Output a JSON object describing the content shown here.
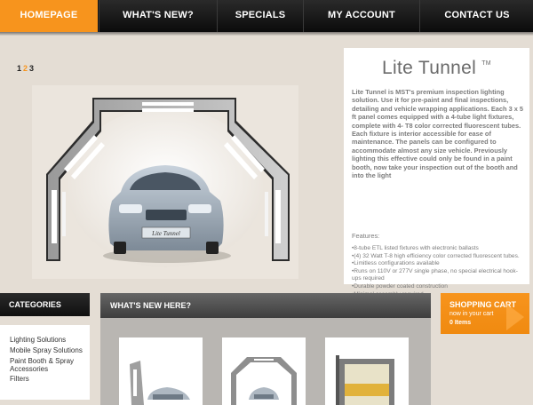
{
  "nav": {
    "items": [
      {
        "label": "HOMEPAGE"
      },
      {
        "label": "WHAT'S NEW?"
      },
      {
        "label": "SPECIALS"
      },
      {
        "label": "MY ACCOUNT"
      },
      {
        "label": "CONTACT US"
      }
    ]
  },
  "pager": {
    "pages": [
      "1",
      "2",
      "3"
    ]
  },
  "hero": {
    "plate": "Lite Tunnel"
  },
  "product": {
    "title": "Lite Tunnel",
    "tm": "TM",
    "description": "Lite Tunnel is MST's premium inspection lighting solution. Use it for pre-paint and final inspections, detailing and vehicle wrapping applications.  Each 3 x 5 ft panel comes equipped with a 4-tube light fixtures, complete with 4- T8 color corrected fluorescent tubes.  Each fixture is interior accessible for ease of maintenance.  The panels can be configured to accommodate almost any size vehicle. Previously lighting this effective could only be found in a paint booth, now take your inspection out of the booth and into the light",
    "features_heading": "Features:",
    "features": [
      "•8-tube ETL listed fixtures with electronic ballasts",
      "•(4) 32 Watt T-8 high efficiency color corrected fluorescent tubes.",
      "•Limitless configurations available",
      "•Runs on 110V or 277V single phase, no special electrical hook-ups required",
      "•Durable powder coated construction",
      "•Minimal assembly required"
    ]
  },
  "categories": {
    "heading": "CATEGORIES",
    "items": [
      "Lighting Solutions",
      "Mobile Spray Solutions",
      "Paint Booth & Spray Accessories",
      "Filters"
    ]
  },
  "whats_new": {
    "heading": "WHAT'S NEW HERE?"
  },
  "cart": {
    "title": "SHOPPING CART",
    "subtitle": "now in your cart",
    "count": "0 Items"
  },
  "colors": {
    "accent": "#f7941d",
    "nav": "#111111",
    "background": "#e4ddd4"
  }
}
